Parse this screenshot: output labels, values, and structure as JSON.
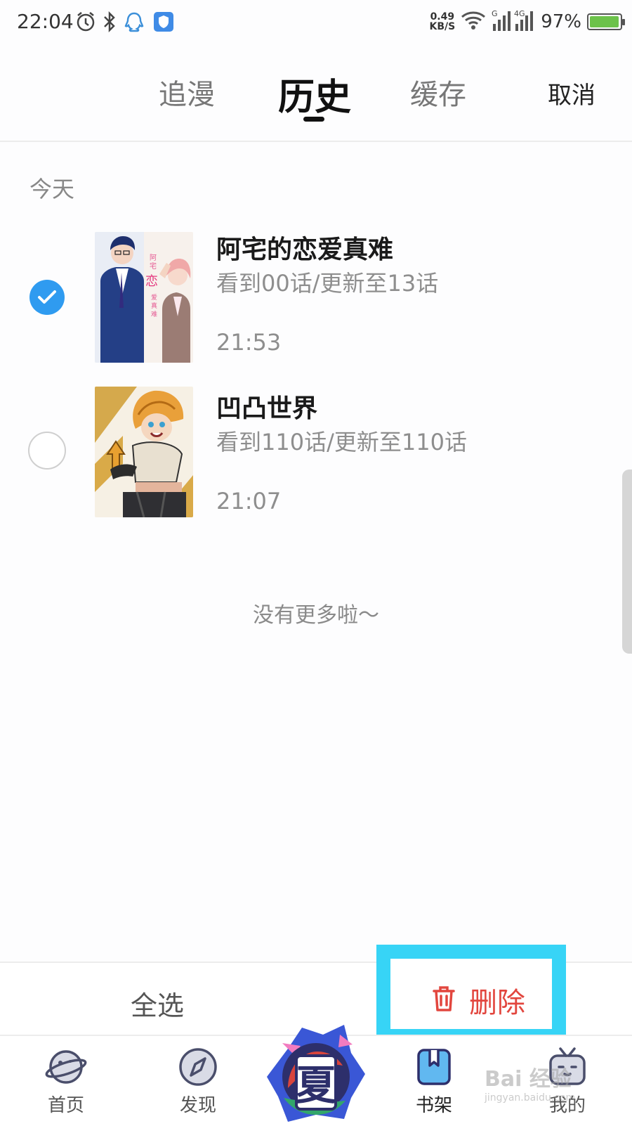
{
  "status_bar": {
    "time": "22:04",
    "net_speed_value": "0.49",
    "net_speed_unit": "KB/S",
    "network_1": "G",
    "network_2": "4G",
    "battery": "97%",
    "battery_level": 0.97,
    "icons": [
      "alarm-icon",
      "bluetooth-icon",
      "qq-icon",
      "shield-icon",
      "wifi-icon",
      "signal-icon",
      "battery-icon"
    ]
  },
  "header": {
    "tabs": [
      {
        "label": "追漫",
        "active": false
      },
      {
        "label": "历史",
        "active": true
      },
      {
        "label": "缓存",
        "active": false
      }
    ],
    "cancel_label": "取消"
  },
  "history": {
    "section_label": "今天",
    "items": [
      {
        "title": "阿宅的恋爱真难",
        "progress": "看到00话/更新至13话",
        "time": "21:53",
        "selected": true
      },
      {
        "title": "凹凸世界",
        "progress": "看到110话/更新至110话",
        "time": "21:07",
        "selected": false
      }
    ],
    "end_text": "没有更多啦～"
  },
  "action_bar": {
    "select_all_label": "全选",
    "delete_label": "删除"
  },
  "bottom_nav": {
    "items": [
      {
        "label": "首页",
        "icon": "planet-icon"
      },
      {
        "label": "发现",
        "icon": "compass-icon"
      },
      {
        "label": "",
        "icon": "summer-badge-icon"
      },
      {
        "label": "书架",
        "icon": "bookshelf-icon",
        "active": true
      },
      {
        "label": "我的",
        "icon": "tv-face-icon"
      }
    ],
    "center_badge_text": "夏"
  },
  "colors": {
    "accent_blue": "#2f9bf0",
    "delete_red": "#e2463e",
    "highlight_cyan": "#37d4f6",
    "battery_green": "#6cc24a"
  },
  "watermark": {
    "text": "Bai 经验",
    "sub": "jingyan.baidu.com"
  }
}
